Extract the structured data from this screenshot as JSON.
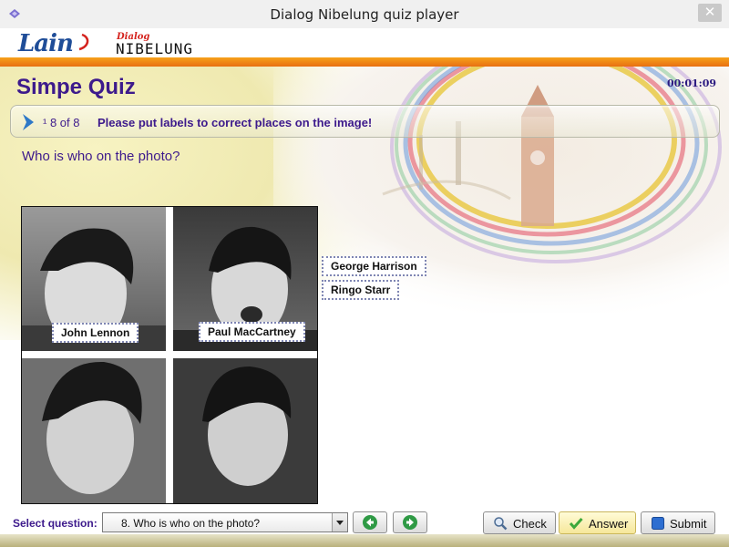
{
  "window": {
    "title": "Dialog Nibelung quiz player"
  },
  "brand": {
    "logo_main": "Lain",
    "logo_dialog": "Dialog",
    "logo_product": "NIBELUNG"
  },
  "quiz": {
    "title": "Simpe Quiz",
    "timer": "00:01:09"
  },
  "question": {
    "current": "8",
    "counter_prefix": "¹ 8  of 8",
    "instruction": "Please put labels to correct places on the image!",
    "text": "Who is who on the photo?"
  },
  "labels": {
    "placed": [
      "John Lennon",
      "Paul MacCartney"
    ],
    "unplaced": [
      "George Harrison",
      "Ringo Starr"
    ]
  },
  "footer": {
    "select_label": "Select question:",
    "selected_question": "8. Who is who on the photo?",
    "check": "Check",
    "answer": "Answer",
    "submit": "Submit"
  },
  "colors": {
    "title": "#3d1a8c",
    "accent_stripe": "#f7a21a",
    "logo_blue": "#1f4d98",
    "logo_red": "#d4231e"
  }
}
